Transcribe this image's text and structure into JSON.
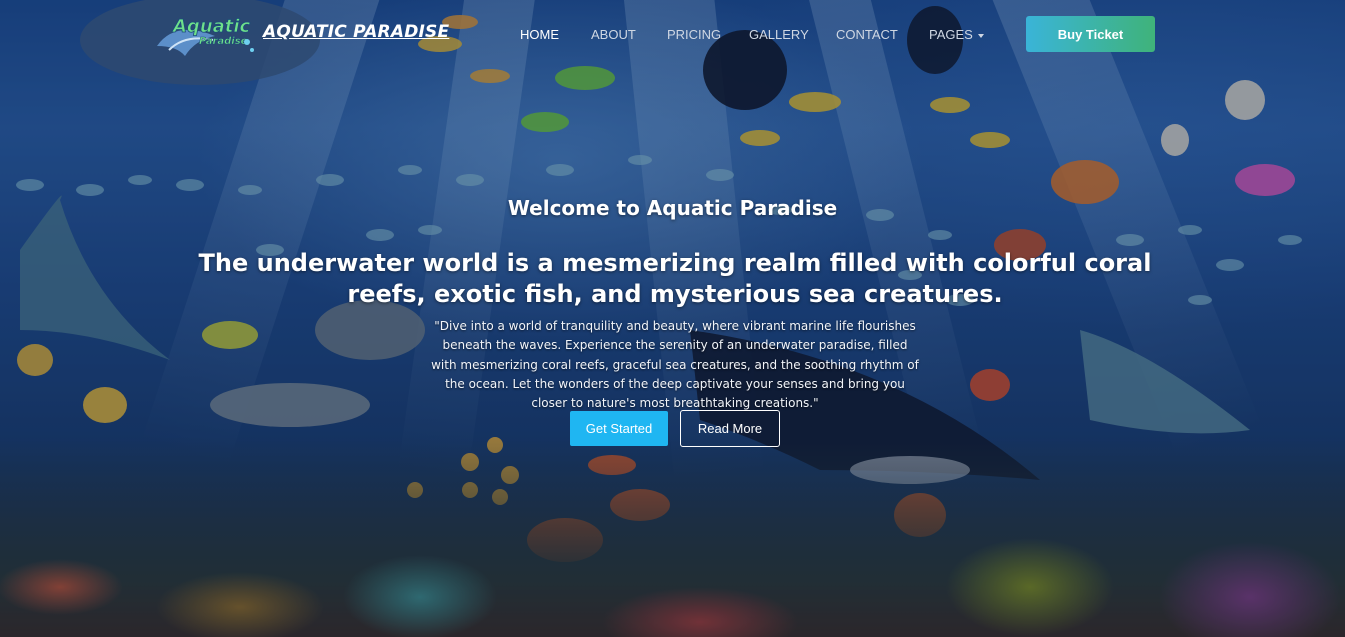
{
  "brand": {
    "logo_text_line1": "Aquatic",
    "logo_text_line2": "Paradise",
    "name": "AQUATIC PARADISE"
  },
  "nav": {
    "items": [
      {
        "label": "HOME",
        "active": true
      },
      {
        "label": "ABOUT",
        "active": false
      },
      {
        "label": "PRICING",
        "active": false
      },
      {
        "label": "GALLERY",
        "active": false
      },
      {
        "label": "CONTACT",
        "active": false
      },
      {
        "label": "PAGES",
        "active": false,
        "dropdown": true
      }
    ],
    "cta_label": "Buy Ticket"
  },
  "hero": {
    "title": "Welcome to Aquatic Paradise",
    "heading": "The underwater world is a mesmerizing realm filled with colorful coral reefs, exotic fish, and mysterious sea creatures.",
    "text": "\"Dive into a world of tranquility and beauty, where vibrant marine life flourishes beneath the waves. Experience the serenity of an underwater paradise, filled with mesmerizing coral reefs, graceful sea creatures, and the soothing rhythm of the ocean. Let the wonders of the deep captivate your senses and bring you closer to nature's most breathtaking creations.\"",
    "primary_button": "Get Started",
    "secondary_button": "Read More"
  },
  "colors": {
    "cta_gradient_start": "#3ab4d8",
    "cta_gradient_end": "#3fb37a",
    "primary_button": "#1fb6f2",
    "nav_link": "#cfd7e3"
  },
  "icons": {
    "logo": "aquatic-paradise-logo",
    "dropdown": "caret-down-icon"
  }
}
